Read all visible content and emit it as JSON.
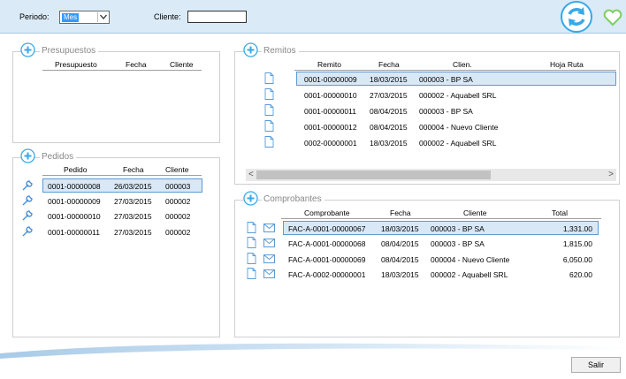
{
  "toolbar": {
    "periodo_label": "Periodo:",
    "periodo_value": "Mes",
    "cliente_label": "Cliente:",
    "cliente_value": ""
  },
  "presupuestos": {
    "title": "Presupuestos",
    "columns": [
      "Presupuesto",
      "Fecha",
      "Cliente"
    ],
    "rows": []
  },
  "pedidos": {
    "title": "Pedidos",
    "columns": [
      "Pedido",
      "Fecha",
      "Cliente"
    ],
    "rows": [
      {
        "pedido": "0001-00000008",
        "fecha": "26/03/2015",
        "cliente": "000003"
      },
      {
        "pedido": "0001-00000009",
        "fecha": "27/03/2015",
        "cliente": "000002"
      },
      {
        "pedido": "0001-00000010",
        "fecha": "27/03/2015",
        "cliente": "000002"
      },
      {
        "pedido": "0001-00000011",
        "fecha": "27/03/2015",
        "cliente": "000002"
      }
    ]
  },
  "remitos": {
    "title": "Remitos",
    "columns": [
      "Remito",
      "Fecha",
      "Clien.",
      "Hoja Ruta"
    ],
    "rows": [
      {
        "remito": "0001-00000009",
        "fecha": "18/03/2015",
        "cliente": "000003 - BP SA",
        "hoja": ""
      },
      {
        "remito": "0001-00000010",
        "fecha": "27/03/2015",
        "cliente": "000002 - Aquabell SRL",
        "hoja": ""
      },
      {
        "remito": "0001-00000011",
        "fecha": "08/04/2015",
        "cliente": "000003 - BP SA",
        "hoja": ""
      },
      {
        "remito": "0001-00000012",
        "fecha": "08/04/2015",
        "cliente": "000004 - Nuevo Cliente",
        "hoja": ""
      },
      {
        "remito": "0002-00000001",
        "fecha": "18/03/2015",
        "cliente": "000002 - Aquabell SRL",
        "hoja": ""
      }
    ],
    "scroll_left": "<",
    "scroll_right": ">"
  },
  "comprobantes": {
    "title": "Comprobantes",
    "columns": [
      "Comprobante",
      "Fecha",
      "Cliente",
      "Total"
    ],
    "rows": [
      {
        "comprobante": "FAC-A-0001-00000067",
        "fecha": "18/03/2015",
        "cliente": "000003 - BP SA",
        "total": "1,331.00"
      },
      {
        "comprobante": "FAC-A-0001-00000068",
        "fecha": "08/04/2015",
        "cliente": "000003 - BP SA",
        "total": "1,815.00"
      },
      {
        "comprobante": "FAC-A-0001-00000069",
        "fecha": "08/04/2015",
        "cliente": "000004 - Nuevo Cliente",
        "total": "6,050.00"
      },
      {
        "comprobante": "FAC-A-0002-00000001",
        "fecha": "18/03/2015",
        "cliente": "000002 - Aquabell SRL",
        "total": "620.00"
      }
    ]
  },
  "footer": {
    "salir_label": "Salir"
  },
  "icons": {
    "plus": "plus-circle-icon",
    "refresh": "refresh-icon",
    "favorite": "heart-icon",
    "wrench": "wrench-icon",
    "document": "document-icon",
    "mail": "mail-icon"
  },
  "colors": {
    "accent": "#36a9e9",
    "topbar": "#daeaf7",
    "selection": "#d9e8f7",
    "heart": "#7ccf5e"
  }
}
